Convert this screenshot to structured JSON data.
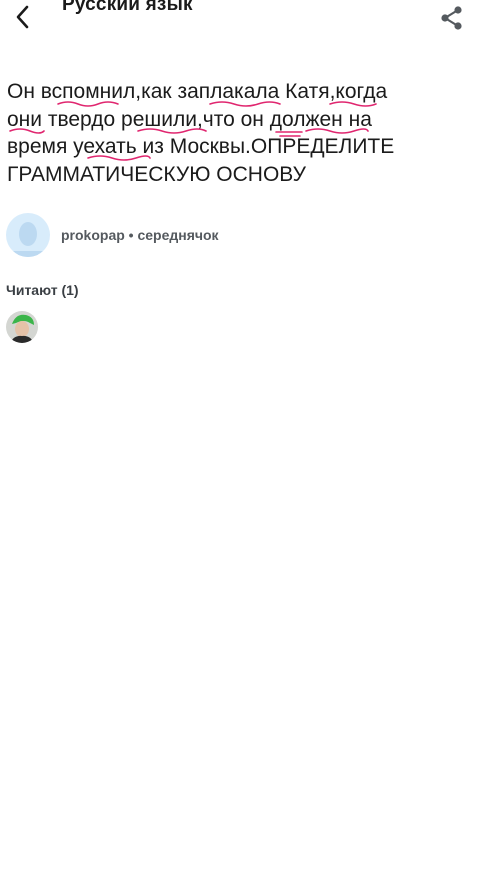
{
  "header": {
    "back_icon": "chevron-left-icon",
    "title": "Русский язык",
    "share_icon": "share-icon"
  },
  "question": {
    "text_line1": "Он вспомнил,как заплакала Катя,когда",
    "text_line2": "они твердо решили,что он должен на",
    "text_line3": "время уехать из Москвы.ОПРЕДЕЛИТЕ",
    "text_line4": "ГРАММАТИЧЕСКУЮ ОСНОВУ"
  },
  "author": {
    "text": "prokopap • середнячок"
  },
  "readers": {
    "label": "Читают (1)"
  },
  "colors": {
    "underline": "#e0266f",
    "avatar_bg": "#d8ecfb",
    "icon": "#555a5f"
  }
}
